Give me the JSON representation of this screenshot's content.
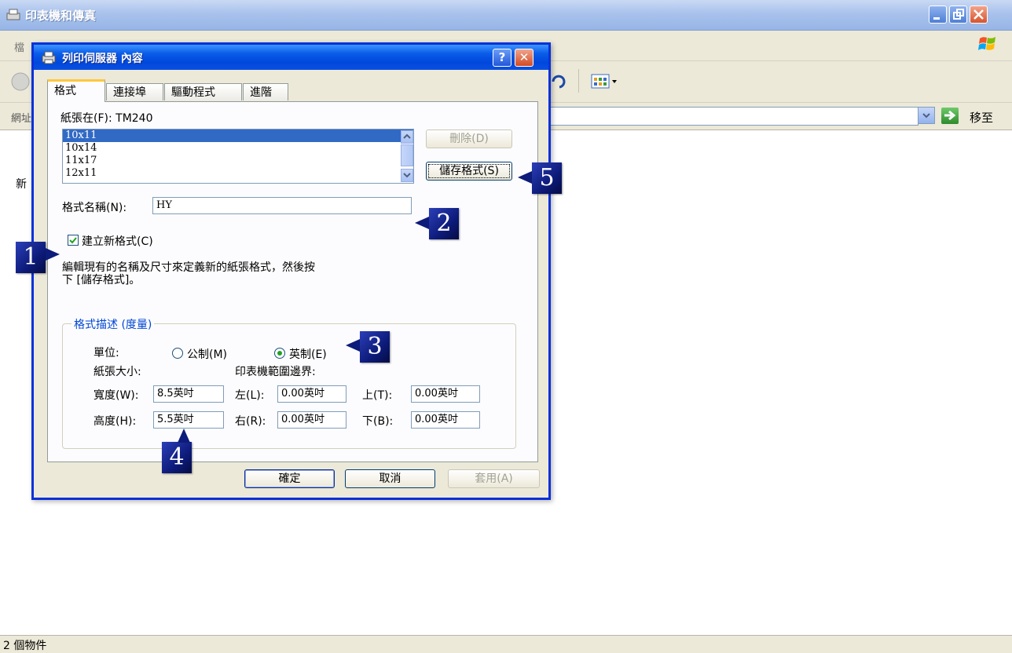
{
  "window": {
    "title": "印表機和傳真",
    "menu_first": "檔",
    "address_label": "網址",
    "go_label": "移至",
    "side_text": "新",
    "status_text": "2 個物件"
  },
  "dialog": {
    "title": "列印伺服器 內容",
    "help_glyph": "?",
    "close_glyph": "✕",
    "tabs": [
      "格式",
      "連接埠",
      "驅動程式",
      "進階"
    ],
    "forms_on_label": "紙張在(F): TM240",
    "forms_list": [
      "10x11",
      "10x14",
      "11x17",
      "12x11"
    ],
    "selected_form": "10x11",
    "delete_button": "刪除(D)",
    "save_button": "儲存格式(S)",
    "form_name_label": "格式名稱(N):",
    "form_name_value": "HY",
    "create_new_label": "建立新格式(C)",
    "create_new_checked": true,
    "description": [
      "編輯現有的名稱及尺寸來定義新的紙張格式，然後按",
      "下 [儲存格式]。"
    ],
    "group_title": "格式描述 (度量)",
    "units_label": "單位:",
    "metric_label": "公制(M)",
    "english_label": "英制(E)",
    "selected_unit": "英制(E)",
    "paper_size_label": "紙張大小:",
    "margins_label": "印表機範圍邊界:",
    "width_label": "寬度(W):",
    "width_value": "8.5英吋",
    "height_label": "高度(H):",
    "height_value": "5.5英吋",
    "left_label": "左(L):",
    "left_value": "0.00英吋",
    "right_label": "右(R):",
    "right_value": "0.00英吋",
    "top_label": "上(T):",
    "top_value": "0.00英吋",
    "bottom_label": "下(B):",
    "bottom_value": "0.00英吋",
    "ok_button": "確定",
    "cancel_button": "取消",
    "apply_button": "套用(A)"
  },
  "callouts": [
    "1",
    "2",
    "3",
    "4",
    "5"
  ],
  "colors": {
    "dialog_title": "#0a5ce8",
    "selection": "#316ac5",
    "group_title": "#0046d5",
    "callout": "#0d1b7a"
  }
}
